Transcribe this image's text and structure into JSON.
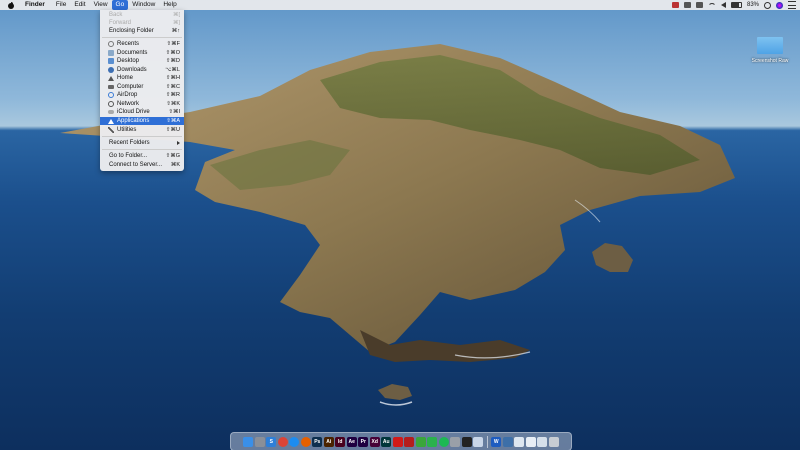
{
  "menubar": {
    "app_name": "Finder",
    "menus": [
      "File",
      "Edit",
      "View",
      "Go",
      "Window",
      "Help"
    ],
    "active_menu": "Go",
    "status_icons": [
      "record-icon",
      "box-icon",
      "app-icon",
      "wifi-icon",
      "volume-icon",
      "battery-icon",
      "search-icon",
      "siri-icon",
      "notification-center-icon"
    ],
    "battery_text": "83%"
  },
  "go_menu": {
    "items": [
      {
        "label": "Back",
        "shortcut": "⌘[",
        "disabled": true
      },
      {
        "label": "Forward",
        "shortcut": "⌘]",
        "disabled": true
      },
      {
        "label": "Enclosing Folder",
        "shortcut": "⌘↑"
      },
      {
        "label": "Recents",
        "shortcut": "⇧⌘F",
        "icon": "clock-icon"
      },
      {
        "label": "Documents",
        "shortcut": "⇧⌘O",
        "icon": "documents-icon"
      },
      {
        "label": "Desktop",
        "shortcut": "⇧⌘D",
        "icon": "desktop-icon"
      },
      {
        "label": "Downloads",
        "shortcut": "⌥⌘L",
        "icon": "downloads-icon"
      },
      {
        "label": "Home",
        "shortcut": "⇧⌘H",
        "icon": "home-icon"
      },
      {
        "label": "Computer",
        "shortcut": "⇧⌘C",
        "icon": "computer-icon"
      },
      {
        "label": "AirDrop",
        "shortcut": "⇧⌘R",
        "icon": "airdrop-icon"
      },
      {
        "label": "Network",
        "shortcut": "⇧⌘K",
        "icon": "network-icon"
      },
      {
        "label": "iCloud Drive",
        "shortcut": "⇧⌘I",
        "icon": "icloud-icon"
      },
      {
        "label": "Applications",
        "shortcut": "⇧⌘A",
        "icon": "applications-icon",
        "highlighted": true
      },
      {
        "label": "Utilities",
        "shortcut": "⇧⌘U",
        "icon": "utilities-icon"
      },
      {
        "label": "Recent Folders",
        "submenu": true
      },
      {
        "label": "Go to Folder...",
        "shortcut": "⇧⌘G"
      },
      {
        "label": "Connect to Server...",
        "shortcut": "⌘K"
      }
    ]
  },
  "desktop": {
    "icon_label": "Screenshot Raw"
  },
  "dock": {
    "apps": [
      {
        "name": "finder-icon",
        "glyph": "",
        "color": "#3a8fe8"
      },
      {
        "name": "launchpad-icon",
        "glyph": "",
        "color": "#8a8f98"
      },
      {
        "name": "safari-icon",
        "glyph": "S",
        "color": "#2e7fd8"
      },
      {
        "name": "chrome-icon",
        "glyph": "",
        "color": "#db4437"
      },
      {
        "name": "safari-compass-icon",
        "glyph": "",
        "color": "#1d8cf0"
      },
      {
        "name": "firefox-icon",
        "glyph": "",
        "color": "#e66000"
      },
      {
        "name": "photoshop-icon",
        "glyph": "Ps",
        "color": "#0d2f4f"
      },
      {
        "name": "illustrator-icon",
        "glyph": "Ai",
        "color": "#4a2300"
      },
      {
        "name": "indesign-icon",
        "glyph": "Id",
        "color": "#49021f"
      },
      {
        "name": "after-effects-icon",
        "glyph": "Ae",
        "color": "#1f0040"
      },
      {
        "name": "premiere-icon",
        "glyph": "Pr",
        "color": "#1f0040"
      },
      {
        "name": "xd-icon",
        "glyph": "Xd",
        "color": "#470137"
      },
      {
        "name": "audition-icon",
        "glyph": "Au",
        "color": "#00363a"
      },
      {
        "name": "acrobat-icon",
        "glyph": "",
        "color": "#d21a1a"
      },
      {
        "name": "filezilla-icon",
        "glyph": "",
        "color": "#b41d1d"
      },
      {
        "name": "upwork-icon",
        "glyph": "",
        "color": "#3aa63a"
      },
      {
        "name": "facetime-icon",
        "glyph": "",
        "color": "#2bb24c"
      },
      {
        "name": "spotify-icon",
        "glyph": "",
        "color": "#1db954"
      },
      {
        "name": "photos-icon",
        "glyph": "",
        "color": "#9aa0a8"
      },
      {
        "name": "terminal-icon",
        "glyph": "",
        "color": "#222222"
      },
      {
        "name": "preview-icon",
        "glyph": "",
        "color": "#c9d6e8"
      },
      {
        "name": "word-icon",
        "glyph": "W",
        "color": "#1e5cc0"
      },
      {
        "name": "network-utility-icon",
        "glyph": "",
        "color": "#3d6fa8"
      },
      {
        "name": "folder-icon",
        "glyph": "",
        "color": "#dde6f0"
      },
      {
        "name": "folder-2-icon",
        "glyph": "",
        "color": "#e8eef5"
      },
      {
        "name": "folder-3-icon",
        "glyph": "",
        "color": "#d5dfea"
      },
      {
        "name": "trash-icon",
        "glyph": "",
        "color": "#c8cdd3"
      }
    ]
  }
}
